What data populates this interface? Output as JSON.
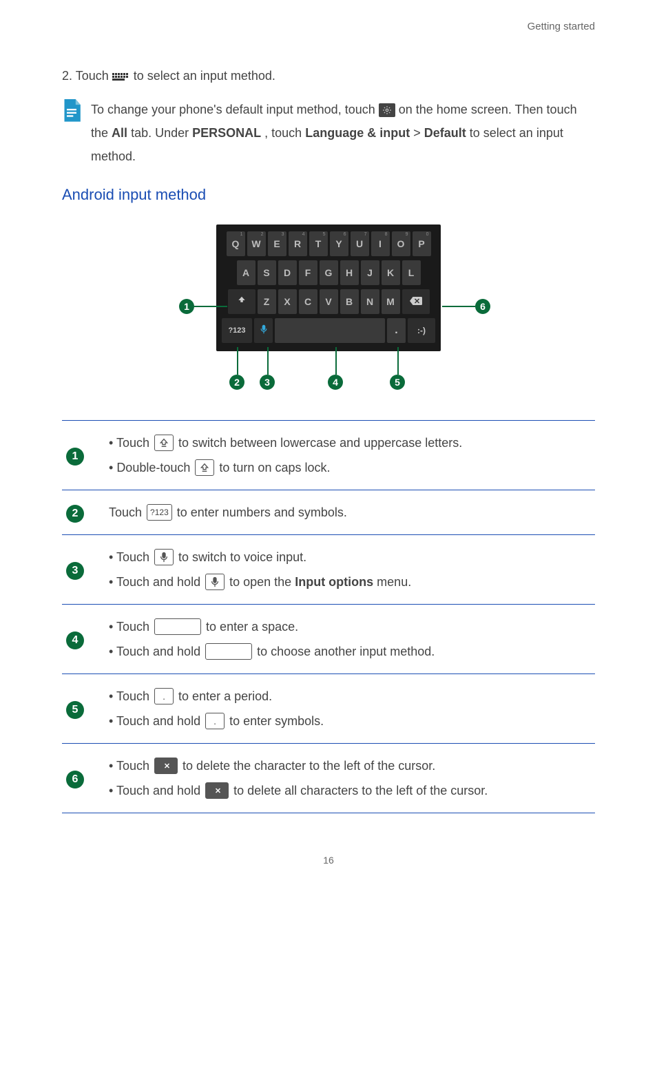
{
  "header": "Getting started",
  "step2_a": "2. Touch ",
  "step2_b": " to select an input method.",
  "note_a": "To change your phone's default input method, touch ",
  "note_b": " on the home screen. Then touch the ",
  "note_all": "All",
  "note_c": " tab. Under ",
  "note_personal": "PERSONAL",
  "note_d": ", touch ",
  "note_lang": "Language & input",
  "note_gt": " > ",
  "note_default": "Default",
  "note_e": " to select an input method.",
  "section_title": "Android input method",
  "kb": {
    "row1": [
      "Q",
      "W",
      "E",
      "R",
      "T",
      "Y",
      "U",
      "I",
      "O",
      "P"
    ],
    "row1_sup": [
      "1",
      "2",
      "3",
      "4",
      "5",
      "6",
      "7",
      "8",
      "9",
      "0"
    ],
    "row2": [
      "A",
      "S",
      "D",
      "F",
      "G",
      "H",
      "J",
      "K",
      "L"
    ],
    "row3": [
      "Z",
      "X",
      "C",
      "V",
      "B",
      "N",
      "M"
    ],
    "k123": "?123",
    "smile": ":-)"
  },
  "callouts": [
    "1",
    "2",
    "3",
    "4",
    "5",
    "6"
  ],
  "rows": {
    "r1a_pre": "Touch ",
    "r1a_post": " to switch between lowercase and uppercase letters.",
    "r1b_pre": "Double-touch ",
    "r1b_post": " to turn on caps lock.",
    "r2_pre": "Touch ",
    "r2_post": " to enter numbers and symbols.",
    "r2_icon_label": "?123",
    "r3a_pre": "Touch ",
    "r3a_post": " to switch to voice input.",
    "r3b_pre": "Touch and hold ",
    "r3b_mid": " to open the ",
    "r3b_bold": "Input options",
    "r3b_post": " menu.",
    "r4a_pre": "Touch ",
    "r4a_post": " to enter a space.",
    "r4b_pre": "Touch and hold ",
    "r4b_post": " to choose another input method.",
    "r5a_pre": "Touch ",
    "r5a_post": " to enter a period.",
    "r5b_pre": "Touch and hold ",
    "r5b_post": " to enter symbols.",
    "r6a_pre": "Touch ",
    "r6a_post": " to delete the character to the left of the cursor.",
    "r6b_pre": "Touch and hold ",
    "r6b_post": " to delete all characters to the left of the cursor."
  },
  "page_number": "16"
}
